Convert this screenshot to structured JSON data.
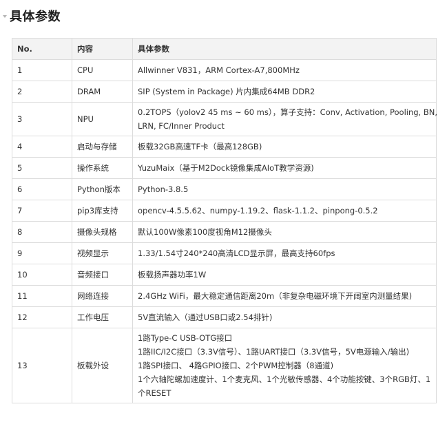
{
  "heading": "具体参数",
  "table": {
    "headers": [
      "No.",
      "内容",
      "具体参数"
    ],
    "rows": [
      {
        "no": "1",
        "item": "CPU",
        "lines": [
          "Allwinner V831，ARM Cortex-A7,800MHz"
        ]
      },
      {
        "no": "2",
        "item": "DRAM",
        "lines": [
          "SIP (System in Package) 片内集成64MB DDR2"
        ]
      },
      {
        "no": "3",
        "item": "NPU",
        "lines": [
          "0.2TOPS（yolov2 45 ms ~ 60 ms），算子支持：Conv, Activation, Pooling, BN,",
          "LRN, FC/Inner Product"
        ]
      },
      {
        "no": "4",
        "item": "启动与存储",
        "lines": [
          "板载32GB高速TF卡（最高128GB)"
        ]
      },
      {
        "no": "5",
        "item": "操作系统",
        "lines": [
          "YuzuMaix（基于M2Dock镜像集成AIoT教学资源)"
        ]
      },
      {
        "no": "6",
        "item": "Python版本",
        "lines": [
          "Python-3.8.5"
        ]
      },
      {
        "no": "7",
        "item": "pip3库支持",
        "lines": [
          "opencv-4.5.5.62、numpy-1.19.2、flask-1.1.2、pinpong-0.5.2"
        ]
      },
      {
        "no": "8",
        "item": "摄像头规格",
        "lines": [
          "默认100W像素100度视角M12摄像头"
        ]
      },
      {
        "no": "9",
        "item": "视频显示",
        "lines": [
          "1.33/1.54寸240*240高清LCD显示屏，最高支持60fps"
        ]
      },
      {
        "no": "10",
        "item": "音频接口",
        "lines": [
          "板载扬声器功率1W"
        ]
      },
      {
        "no": "11",
        "item": "网络连接",
        "lines": [
          "2.4GHz WiFi，最大稳定通信距离20m（非复杂电磁环境下开阔室内测量结果)"
        ]
      },
      {
        "no": "12",
        "item": "工作电压",
        "lines": [
          "5V直流输入（通过USB口或2.54排针)"
        ]
      },
      {
        "no": "13",
        "item": "板载外设",
        "lines": [
          "1路Type-C USB-OTG接口",
          "1路IIC/I2C接口（3.3V信号）、1路UART接口（3.3V信号，5V电源输入/输出)",
          "1路SPI接口、 4路GPIO接口、2个PWM控制器（8通道)",
          "1个六轴陀螺加速度计、1个麦克风、1个光敏传感器、4个功能按键、3个RGB灯、1",
          "个RESET"
        ]
      }
    ]
  }
}
